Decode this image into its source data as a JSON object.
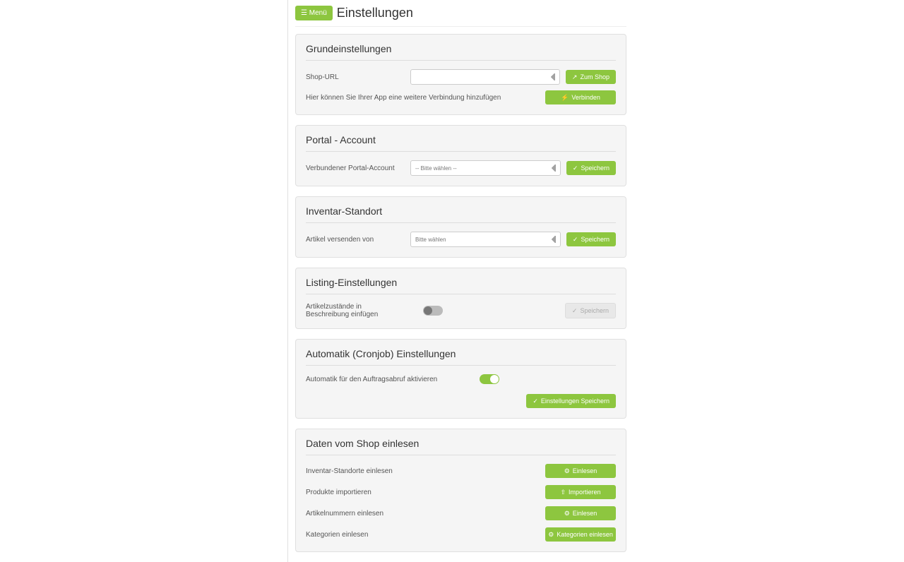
{
  "menu_btn": "☰ Menü",
  "page_title": "Einstellungen",
  "panels": {
    "basic": {
      "title": "Grundeinstellungen",
      "shop_url_label": "Shop-URL",
      "shop_url_value": "",
      "to_shop_btn": "Zum Shop",
      "connect_hint": "Hier können Sie Ihrer App eine weitere Verbindung hinzufügen",
      "connect_btn": "Verbinden"
    },
    "portal": {
      "title": "Portal - Account",
      "label": "Verbundener Portal-Account",
      "placeholder": "-- Bitte wählen --",
      "save_btn": "Speichern"
    },
    "inventory": {
      "title": "Inventar-Standort",
      "label": "Artikel versenden von",
      "placeholder": "Bitte wählen",
      "save_btn": "Speichern"
    },
    "listing": {
      "title": "Listing-Einstellungen",
      "label": "Artikelzustände in Beschreibung einfügen",
      "save_btn": "Speichern"
    },
    "automatic": {
      "title": "Automatik (Cronjob) Einstellungen",
      "label": "Automatik für den Auftragsabruf aktivieren",
      "save_btn": "Einstellungen Speichern"
    },
    "import": {
      "title": "Daten vom Shop einlesen",
      "rows": [
        {
          "label": "Inventar-Standorte einlesen",
          "btn": "Einlesen"
        },
        {
          "label": "Produkte importieren",
          "btn": "Importieren"
        },
        {
          "label": "Artikelnummern einlesen",
          "btn": "Einlesen"
        },
        {
          "label": "Kategorien einlesen",
          "btn": "Kategorien einlesen"
        }
      ]
    }
  },
  "icons": {
    "checkmark": "✓",
    "external": "↗",
    "plug": "⚡",
    "gears": "⚙",
    "upload": "⇧"
  }
}
